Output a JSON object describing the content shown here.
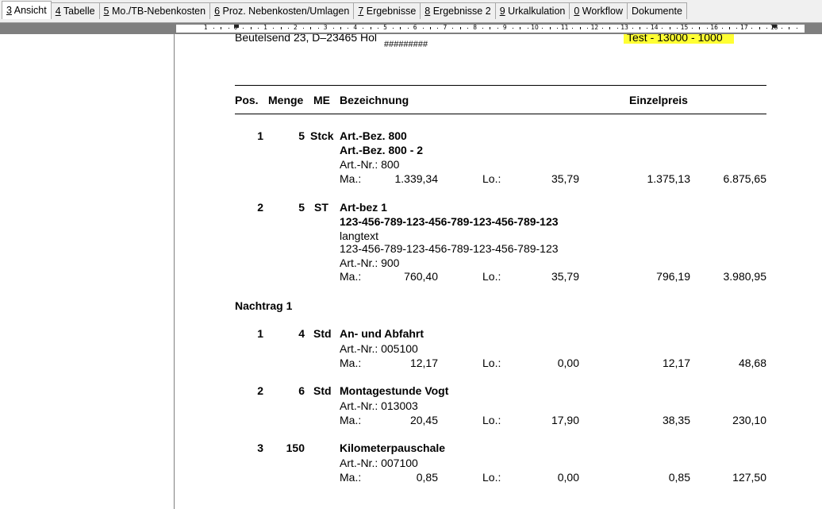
{
  "tabs": [
    {
      "key": "3",
      "label": " Ansicht",
      "active": true
    },
    {
      "key": "4",
      "label": " Tabelle",
      "active": false
    },
    {
      "key": "5",
      "label": " Mo./TB-Nebenkosten",
      "active": false
    },
    {
      "key": "6",
      "label": " Proz. Nebenkosten/Umlagen",
      "active": false
    },
    {
      "key": "7",
      "label": " Ergebnisse",
      "active": false
    },
    {
      "key": "8",
      "label": " Ergebnisse 2",
      "active": false
    },
    {
      "key": "9",
      "label": " Urkalkulation",
      "active": false
    },
    {
      "key": "0",
      "label": " Workflow",
      "active": false
    },
    {
      "key": "",
      "label": "Dokumente",
      "active": false
    }
  ],
  "ruler": {
    "labels": [
      "1",
      "0",
      "1",
      "2",
      "3",
      "4",
      "5",
      "6",
      "7",
      "8",
      "9",
      "10",
      "11",
      "12",
      "13",
      "14",
      "15",
      "16",
      "17",
      "18"
    ]
  },
  "document": {
    "address_line": "Beutelsend 23, D–23465 Hol",
    "hash_mark": "#########",
    "highlight_text": "Test - 13000 - 1000",
    "header": {
      "pos": "Pos.",
      "menge": "Menge",
      "me": "ME",
      "bezeichnung": "Bezeichnung",
      "einzelpreis": "Einzelpreis"
    },
    "items": [
      {
        "pos": "1",
        "menge": "5",
        "me": "Stck",
        "title": "Art.-Bez. 800",
        "subtitle": "Art.-Bez. 800 - 2",
        "artnr": "Art.-Nr.: 800",
        "ma_label": "Ma.:",
        "ma_value": "1.339,34",
        "lo_label": "Lo.:",
        "lo_value": "35,79",
        "einzelpreis": "1.375,13",
        "gesamt": "6.875,65"
      },
      {
        "pos": "2",
        "menge": "5",
        "me": "ST",
        "title": "Art-bez 1",
        "subtitle": "123-456-789-123-456-789-123-456-789-123",
        "langtext_label": "langtext",
        "langtext": "123-456-789-123-456-789-123-456-789-123",
        "artnr": "Art.-Nr.: 900",
        "ma_label": "Ma.:",
        "ma_value": "760,40",
        "lo_label": "Lo.:",
        "lo_value": "35,79",
        "einzelpreis": "796,19",
        "gesamt": "3.980,95"
      }
    ],
    "nachtrag_title": "Nachtrag 1",
    "nachtrag_items": [
      {
        "pos": "1",
        "menge": "4",
        "me": "Std",
        "title": "An- und Abfahrt",
        "artnr": "Art.-Nr.: 005100",
        "ma_label": "Ma.:",
        "ma_value": "12,17",
        "lo_label": "Lo.:",
        "lo_value": "0,00",
        "einzelpreis": "12,17",
        "gesamt": "48,68"
      },
      {
        "pos": "2",
        "menge": "6",
        "me": "Std",
        "title": "Montagestunde Vogt",
        "artnr": "Art.-Nr.: 013003",
        "ma_label": "Ma.:",
        "ma_value": "20,45",
        "lo_label": "Lo.:",
        "lo_value": "17,90",
        "einzelpreis": "38,35",
        "gesamt": "230,10"
      },
      {
        "pos": "3",
        "menge": "150",
        "me": "",
        "title": "Kilometerpauschale",
        "artnr": "Art.-Nr.: 007100",
        "ma_label": "Ma.:",
        "ma_value": "0,85",
        "lo_label": "Lo.:",
        "lo_value": "0,00",
        "einzelpreis": "0,85",
        "gesamt": "127,50"
      }
    ]
  },
  "colors": {
    "highlight": "#ffff33",
    "ruler_frame": "#7f7f7f",
    "tab_background": "#f0f0f0"
  }
}
